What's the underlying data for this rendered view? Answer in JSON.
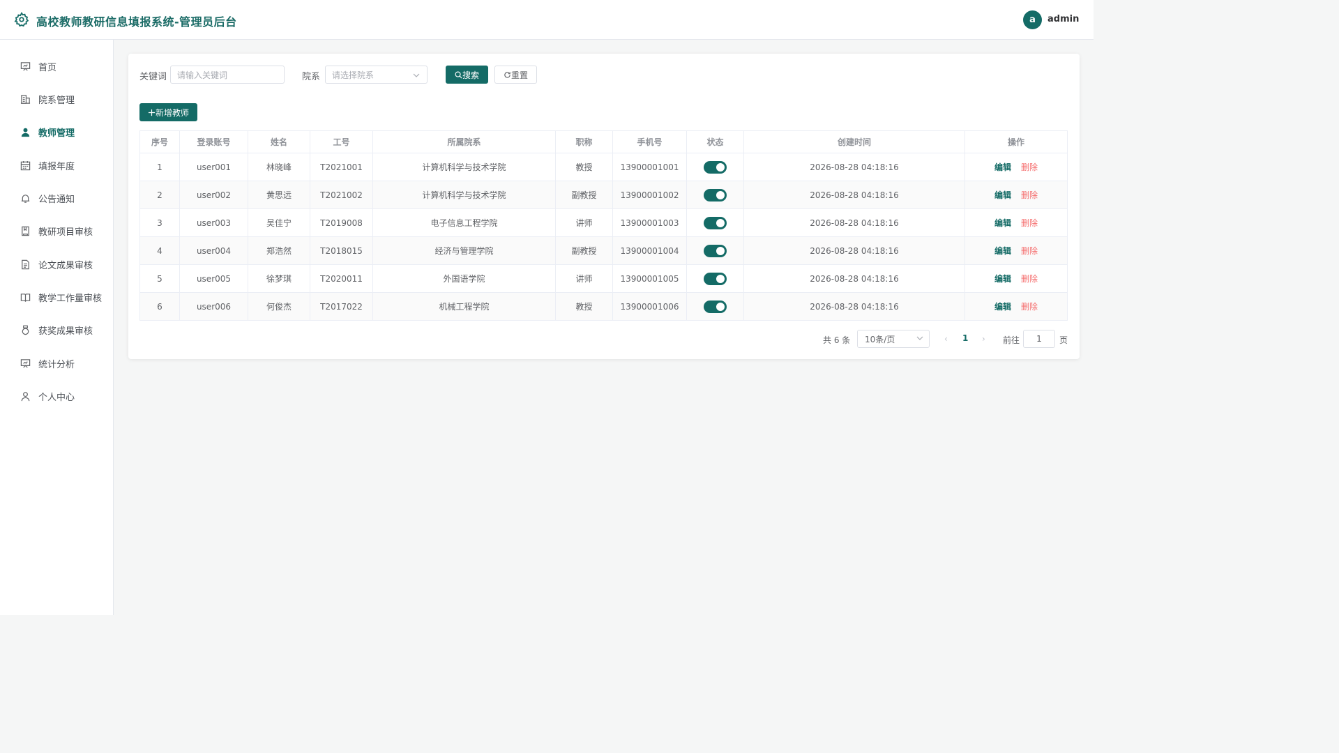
{
  "header": {
    "title": "高校教师教研信息填报系统-管理员后台",
    "avatar_letter": "a",
    "username": "admin",
    "accent_color": "#146b66"
  },
  "sidebar": {
    "items": [
      {
        "label": "首页",
        "icon": "home-board-icon"
      },
      {
        "label": "院系管理",
        "icon": "building-icon"
      },
      {
        "label": "教师管理",
        "icon": "user-icon",
        "active": true
      },
      {
        "label": "填报年度",
        "icon": "calendar-icon"
      },
      {
        "label": "公告通知",
        "icon": "bell-icon"
      },
      {
        "label": "教研项目审核",
        "icon": "notebook-icon"
      },
      {
        "label": "论文成果审核",
        "icon": "document-icon"
      },
      {
        "label": "教学工作量审核",
        "icon": "book-icon"
      },
      {
        "label": "获奖成果审核",
        "icon": "medal-icon"
      },
      {
        "label": "统计分析",
        "icon": "presentation-icon"
      },
      {
        "label": "个人中心",
        "icon": "user-outline-icon"
      }
    ]
  },
  "filters": {
    "keyword_label": "关键词",
    "keyword_placeholder": "请输入关键词",
    "dept_label": "院系",
    "dept_placeholder": "请选择院系",
    "search_label": "搜索",
    "reset_label": "重置",
    "add_label": "新增教师"
  },
  "table": {
    "columns": [
      "序号",
      "登录账号",
      "姓名",
      "工号",
      "所属院系",
      "职称",
      "手机号",
      "状态",
      "创建时间",
      "操作"
    ],
    "edit_label": "编辑",
    "delete_label": "删除",
    "rows": [
      {
        "no": "1",
        "account": "user001",
        "name": "林晓峰",
        "staff_id": "T2021001",
        "dept": "计算机科学与技术学院",
        "title": "教授",
        "phone": "13900001001",
        "enabled": true,
        "created": "2026-08-28 04:18:16"
      },
      {
        "no": "2",
        "account": "user002",
        "name": "黄思远",
        "staff_id": "T2021002",
        "dept": "计算机科学与技术学院",
        "title": "副教授",
        "phone": "13900001002",
        "enabled": true,
        "created": "2026-08-28 04:18:16"
      },
      {
        "no": "3",
        "account": "user003",
        "name": "吴佳宁",
        "staff_id": "T2019008",
        "dept": "电子信息工程学院",
        "title": "讲师",
        "phone": "13900001003",
        "enabled": true,
        "created": "2026-08-28 04:18:16"
      },
      {
        "no": "4",
        "account": "user004",
        "name": "郑浩然",
        "staff_id": "T2018015",
        "dept": "经济与管理学院",
        "title": "副教授",
        "phone": "13900001004",
        "enabled": true,
        "created": "2026-08-28 04:18:16"
      },
      {
        "no": "5",
        "account": "user005",
        "name": "徐梦琪",
        "staff_id": "T2020011",
        "dept": "外国语学院",
        "title": "讲师",
        "phone": "13900001005",
        "enabled": true,
        "created": "2026-08-28 04:18:16"
      },
      {
        "no": "6",
        "account": "user006",
        "name": "何俊杰",
        "staff_id": "T2017022",
        "dept": "机械工程学院",
        "title": "教授",
        "phone": "13900001006",
        "enabled": true,
        "created": "2026-08-28 04:18:16"
      }
    ]
  },
  "pagination": {
    "total_text": "共 6 条",
    "page_size": "10条/页",
    "current_page": "1",
    "goto_label": "前往",
    "goto_value": "1",
    "page_suffix": "页"
  }
}
